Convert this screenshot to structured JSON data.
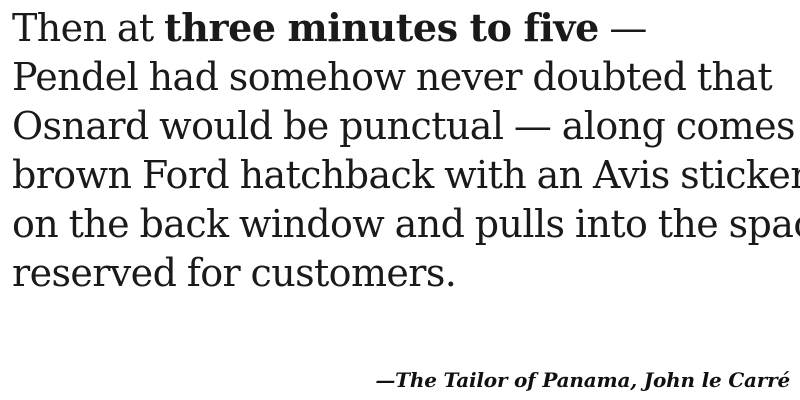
{
  "quote": {
    "line1_before": "Then at ",
    "line1_emph": "three minutes to five",
    "line1_after": " —",
    "line2": "Pendel had somehow never doubted that",
    "line3": "Osnard would be punctual — along comes a",
    "line4": "brown Ford hatchback with an Avis sticker",
    "line5": "on the back window and pulls into the space",
    "line6": "reserved for customers."
  },
  "attribution": {
    "dash": "—",
    "title": "The Tailor of Panama",
    "separator": ", ",
    "author": "John le Carré"
  },
  "colors": {
    "text": "#1a1a1a",
    "background": "#ffffff"
  }
}
